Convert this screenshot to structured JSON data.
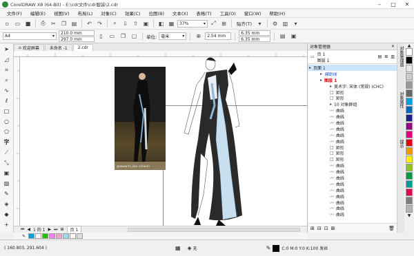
{
  "window": {
    "title": "CorelDRAW X8 (64-Bit) - E:\\cdr文件\\cdr服装\\2.cdr"
  },
  "menu": [
    "文件(F)",
    "编辑(E)",
    "视图(V)",
    "布局(L)",
    "对象(C)",
    "效果(C)",
    "位图(B)",
    "文本(X)",
    "表格(T)",
    "工具(O)",
    "窗口(W)",
    "帮助(H)"
  ],
  "toolbar": {
    "zoom": "37%",
    "snap": "贴齐(T)"
  },
  "props": {
    "page_size": "A4",
    "width": "210.0 mm",
    "height": "297.0 mm",
    "units_label": "单位:",
    "units": "毫米",
    "nudge": "2.54 mm",
    "dup_x": "6.35 mm",
    "dup_y": "6.35 mm"
  },
  "tabs": [
    "欢迎屏幕",
    "未命名 -1",
    "2.cdr"
  ],
  "page_nav": {
    "counter": "1 的 1",
    "page": "页 1"
  },
  "panel": {
    "title": "对象管理器",
    "page_line": "页 1",
    "layer_line": "图层 1",
    "rows": [
      {
        "label": "页面 1",
        "indent": 2,
        "selected": true
      },
      {
        "label": "辅助线",
        "indent": 18
      },
      {
        "label": "图层 1",
        "indent": 18
      },
      {
        "label": "美术字: 宋体 (常规) (CHC)",
        "indent": 32
      },
      {
        "label": "矩形",
        "indent": 32
      },
      {
        "label": "矩形",
        "indent": 32
      },
      {
        "label": "10 对象群组",
        "indent": 32
      },
      {
        "label": "曲线",
        "indent": 32
      },
      {
        "label": "曲线",
        "indent": 32
      },
      {
        "label": "曲线",
        "indent": 32
      },
      {
        "label": "曲线",
        "indent": 32
      },
      {
        "label": "曲线",
        "indent": 32
      },
      {
        "label": "曲线",
        "indent": 32
      },
      {
        "label": "矩形",
        "indent": 32
      },
      {
        "label": "矩形",
        "indent": 32
      },
      {
        "label": "矩形",
        "indent": 32
      },
      {
        "label": "曲线",
        "indent": 32
      },
      {
        "label": "曲线",
        "indent": 32
      },
      {
        "label": "曲线",
        "indent": 32
      },
      {
        "label": "曲线",
        "indent": 32
      },
      {
        "label": "曲线",
        "indent": 32
      },
      {
        "label": "曲线",
        "indent": 32
      },
      {
        "label": "曲线",
        "indent": 32
      },
      {
        "label": "曲线",
        "indent": 32
      },
      {
        "label": "曲线",
        "indent": 32
      }
    ]
  },
  "side_tabs": [
    "对象管理器",
    "对象属性",
    "提示"
  ],
  "photo_watermark": "@www.fu jian xinwen",
  "status": {
    "coords": "( 160.803, 291.604 )",
    "fill_none": "无",
    "color_info": "C:0 M:0 Y:0 K:100 发丝"
  },
  "palette": [
    "#ffffff",
    "#000000",
    "#e6e6e6",
    "#cccccc",
    "#999999",
    "#666666",
    "#00a0e9",
    "#0068b7",
    "#1d2088",
    "#920783",
    "#e4007f",
    "#e60012",
    "#f39800",
    "#fff100",
    "#8fc31f",
    "#009944",
    "#009e96",
    "#e5004f",
    "#7d7d7d",
    "#b5b5b5"
  ],
  "swatches": [
    "#00a0e9",
    "#ffffff",
    "#22c000",
    "#ee82ee",
    "#f4a6c8",
    "#a0d8ef",
    "#ffffff",
    "#dddddd"
  ]
}
